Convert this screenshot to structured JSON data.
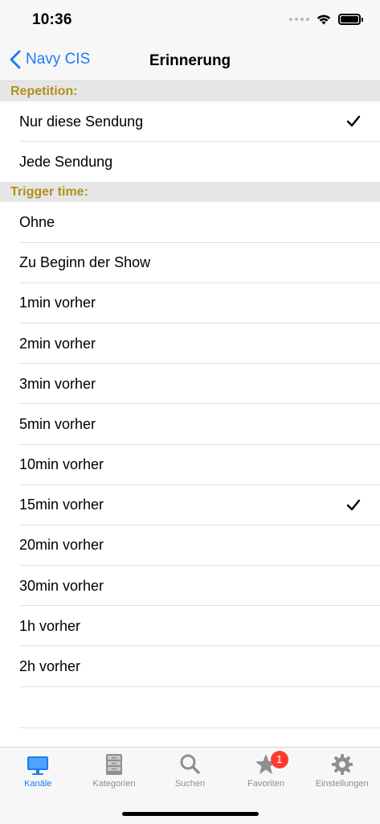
{
  "status_bar": {
    "time": "10:36"
  },
  "nav": {
    "back_label": "Navy CIS",
    "title": "Erinnerung"
  },
  "sections": [
    {
      "header": "Repetition:",
      "items": [
        {
          "label": "Nur diese Sendung",
          "checked": true
        },
        {
          "label": "Jede Sendung",
          "checked": false
        }
      ]
    },
    {
      "header": "Trigger time:",
      "items": [
        {
          "label": "Ohne",
          "checked": false
        },
        {
          "label": "Zu Beginn der Show",
          "checked": false
        },
        {
          "label": "1min vorher",
          "checked": false
        },
        {
          "label": "2min vorher",
          "checked": false
        },
        {
          "label": "3min vorher",
          "checked": false
        },
        {
          "label": "5min vorher",
          "checked": false
        },
        {
          "label": "10min vorher",
          "checked": false
        },
        {
          "label": "15min vorher",
          "checked": true
        },
        {
          "label": "20min vorher",
          "checked": false
        },
        {
          "label": "30min vorher",
          "checked": false
        },
        {
          "label": "1h vorher",
          "checked": false
        },
        {
          "label": "2h vorher",
          "checked": false
        }
      ]
    }
  ],
  "tab_bar": {
    "tabs": [
      {
        "label": "Kanäle",
        "icon": "monitor-icon",
        "active": true
      },
      {
        "label": "Kategorien",
        "icon": "cabinet-icon",
        "active": false
      },
      {
        "label": "Suchen",
        "icon": "search-icon",
        "active": false
      },
      {
        "label": "Favoriten",
        "icon": "star-icon",
        "active": false,
        "badge": "1"
      },
      {
        "label": "Einstellungen",
        "icon": "gear-icon",
        "active": false
      }
    ]
  },
  "colors": {
    "accent": "#1a7cf5",
    "section_header_text": "#b0901b",
    "badge": "#ff3b30",
    "inactive_tab": "#8e8e93"
  }
}
